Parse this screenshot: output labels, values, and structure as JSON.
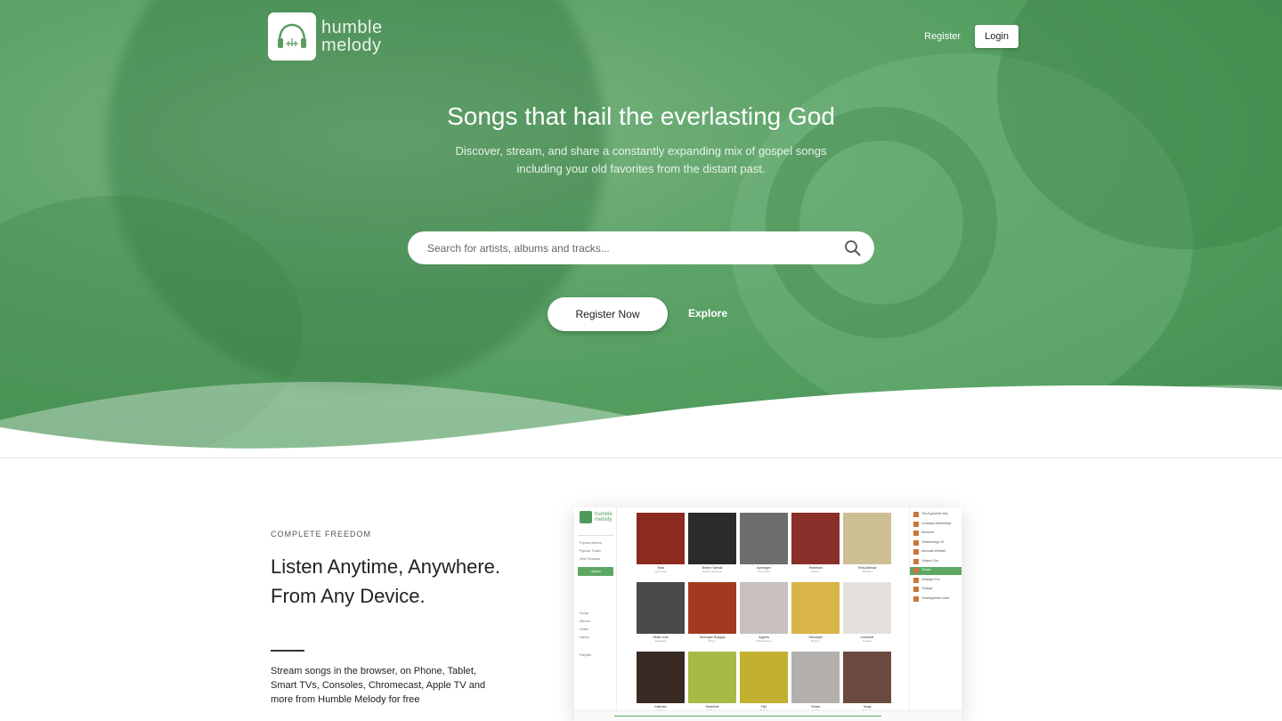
{
  "brand": {
    "name_line1": "humble",
    "name_line2": "melody"
  },
  "nav": {
    "register_label": "Register",
    "login_label": "Login"
  },
  "hero": {
    "title": "Songs that hail the everlasting God",
    "subtitle": "Discover, stream, and share a constantly expanding mix of gospel songs including your old favorites from the distant past.",
    "search_placeholder": "Search for artists, albums and tracks...",
    "cta_label": "Register Now",
    "explore_label": "Explore"
  },
  "feature": {
    "kicker": "COMPLETE FREEDOM",
    "title": "Listen Anytime, Anywhere. From Any Device.",
    "description": "Stream songs in the browser, on Phone, Tablet, Smart TVs, Consoles, Chromecast, Apple TV and more from Humble Melody for free"
  },
  "mockup": {
    "sidebar_nav": [
      "Popular Albums",
      "Popular Tracks",
      "New Releases"
    ],
    "sidebar_button": "Upload",
    "library_nav": [
      "Songs",
      "Albums",
      "Artists",
      "History"
    ],
    "playlists_label": "Playlists",
    "albums": [
      {
        "title": "Tesfa",
        "artist": "Ayda Mulu",
        "color": "#8b2a1e"
      },
      {
        "title": "Bekem Yalenal",
        "artist": "Dawit Getachew",
        "color": "#2b2b2b"
      },
      {
        "title": "Aymesgen",
        "artist": "Kiya Tame",
        "color": "#6d6d6d"
      },
      {
        "title": "Yeabrham",
        "artist": "Getaye",
        "color": "#8a2f2a"
      },
      {
        "title": "Tesfa Alemaw",
        "artist": "Shanbel",
        "color": "#cdbe94"
      },
      {
        "title": "Dibab Lene",
        "artist": "Dagmawi",
        "color": "#4a4a4a"
      },
      {
        "title": "Yemesgen Buagign",
        "artist": "Efrem",
        "color": "#a33a20"
      },
      {
        "title": "Aygeba",
        "artist": "Yidnekachew",
        "color": "#c7c0bd"
      },
      {
        "title": "Yadonayie",
        "artist": "Bekele",
        "color": "#d9b548"
      },
      {
        "title": "Lewerede",
        "artist": "Tesfaye",
        "color": "#e4e0dc"
      },
      {
        "title": "Kalkidan",
        "artist": "Haleluya",
        "color": "#3a2a24"
      },
      {
        "title": "Yewedede",
        "artist": "Meskerem",
        "color": "#a9b946"
      },
      {
        "title": "Fikir",
        "artist": "Bethel",
        "color": "#c4b030"
      },
      {
        "title": "Yeneta",
        "artist": "Teddy",
        "color": "#b3afad"
      },
      {
        "title": "Tsega",
        "artist": "Samuel",
        "color": "#6a4a40"
      }
    ],
    "queue": [
      "Yiku Egziabher Mey",
      "Lemesgin Aldekebegn",
      "Ebenezer",
      "Yebeluhalegn Ot",
      "Ademaki Medhani",
      "Yihalew Cha",
      "Yihune",
      "Zelalegm Fhu",
      "Yihdega",
      "Yemeslgenhew Geta"
    ],
    "queue_active_index": 6,
    "now_playing": "Yihune"
  }
}
